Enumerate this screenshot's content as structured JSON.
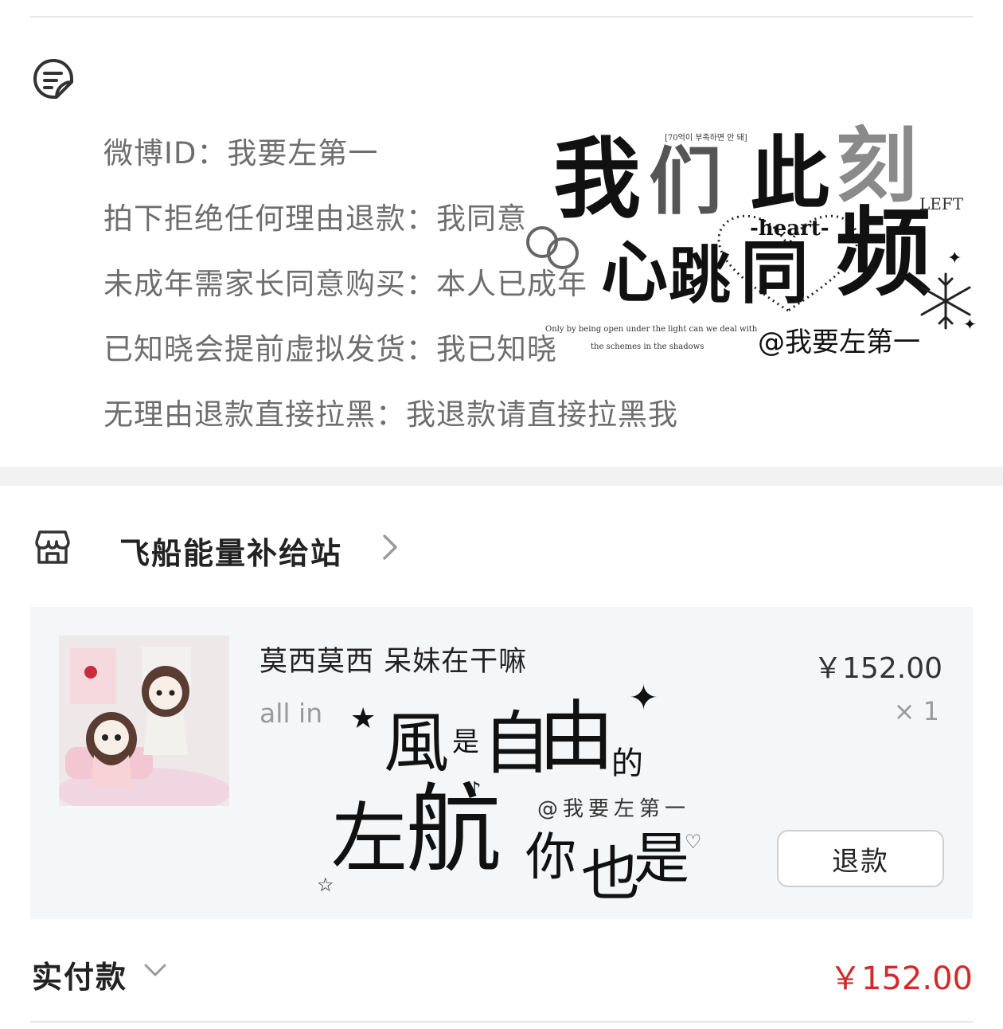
{
  "notes": {
    "icon": "note-icon",
    "lines": [
      "微博ID：我要左第一",
      "拍下拒绝任何理由退款：我同意",
      "未成年需家长同意购买：本人已成年",
      "已知晓会提前虚拟发货：我已知晓",
      "无理由退款直接拉黑：我退款请直接拉黑我"
    ]
  },
  "watermark1": {
    "korean": "[70억이 부족하면 안 돼]",
    "chars": [
      "我",
      "们",
      "此",
      "刻"
    ],
    "left": "LEFT",
    "heart": "-heart-",
    "line2": [
      "心",
      "跳",
      "同",
      "频"
    ],
    "quote1": "Only by being open under the light can we deal with",
    "quote2": "the schemes in the shadows",
    "handle": "@我要左第一"
  },
  "shop": {
    "icon": "store-icon",
    "name": "飞船能量补给站"
  },
  "item": {
    "title": "莫西莫西 呆妹在干嘛",
    "variant": "all in",
    "price": "￥152.00",
    "qty": "× 1",
    "refund_label": "退款"
  },
  "watermark2": {
    "line1": [
      "風",
      "是",
      "自",
      "由",
      "的"
    ],
    "handle": "@我要左第一",
    "line2": [
      "左",
      "航",
      "你",
      "也",
      "是"
    ]
  },
  "payment": {
    "label": "实付款",
    "amount": "￥152.00"
  },
  "colors": {
    "price_red": "#d22a2a",
    "muted_text": "#6e6e6e",
    "card_bg": "#f5f6f8"
  }
}
